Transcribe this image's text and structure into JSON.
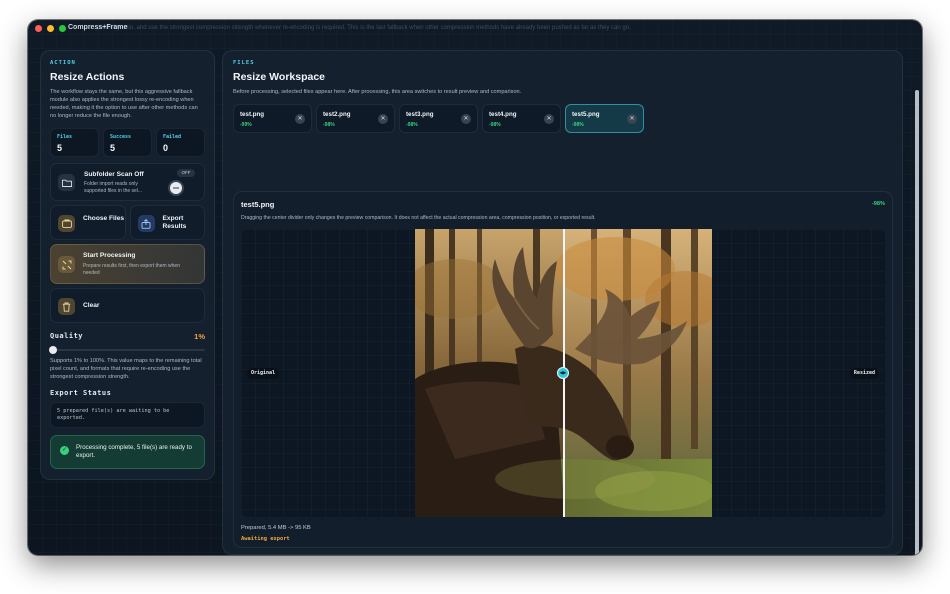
{
  "window": {
    "title": "Compress+Frame",
    "background_text": "... pixels by ratio, and use the strongest compression strength whenever re-encoding is required. This is the last fallback when other compression methods have already been pushed as far as they can go."
  },
  "sidebar": {
    "kicker": "ACTION",
    "title": "Resize Actions",
    "description": "The workflow stays the same, but this aggressive fallback module also applies the strongest lossy re-encoding when needed, making it the option to use after other methods can no longer reduce the file enough.",
    "stats": [
      {
        "label": "Files",
        "value": "5"
      },
      {
        "label": "Success",
        "value": "5"
      },
      {
        "label": "Failed",
        "value": "0"
      }
    ],
    "subfolder": {
      "title": "Subfolder Scan Off",
      "subtitle": "Folder import reads only supported files in the sel...",
      "toggle_label": "OFF"
    },
    "choose_files": "Choose Files",
    "export_results": "Export Results",
    "start": {
      "title": "Start Processing",
      "subtitle": "Prepare results first, then export them when needed"
    },
    "clear": "Clear",
    "quality": {
      "label": "Quality",
      "value_text": "1%",
      "level_percent": 1
    },
    "quality_help": "Supports 1% to 100%. This value maps to the remaining total pixel count, and formats that require re-encoding use the strongest compression strength.",
    "export_status_title": "Export Status",
    "export_status_text": "5 prepared file(s) are waiting to be exported.",
    "success_message": "Processing complete, 5 file(s) are ready to export."
  },
  "workspace": {
    "kicker": "FILES",
    "title": "Resize Workspace",
    "description": "Before processing, selected files appear here. After processing, this area switches to result preview and comparison.",
    "files": [
      {
        "name": "test.png",
        "pct": "-99%"
      },
      {
        "name": "test2.png",
        "pct": "-98%"
      },
      {
        "name": "test3.png",
        "pct": "-98%"
      },
      {
        "name": "test4.png",
        "pct": "-98%"
      },
      {
        "name": "test5.png",
        "pct": "-98%"
      }
    ],
    "preview": {
      "title": "test5.png",
      "pct": "-98%",
      "description": "Dragging the center divider only changes the preview comparison. It does not affect the actual compression area, compression position, or exported result.",
      "left_tag": "Original",
      "right_tag": "Resized",
      "handle_text": "◀▶",
      "prepared": "Prepared, 5.4 MB -> 95 KB",
      "status": "Awaiting export"
    }
  },
  "colors": {
    "accent": "#4fd4e6",
    "success": "#3ad07c",
    "warning": "#f0a53a"
  },
  "icons": [
    "folder-icon",
    "choose-files-icon",
    "export-icon",
    "process-icon",
    "trash-icon",
    "close-icon",
    "check-icon"
  ]
}
